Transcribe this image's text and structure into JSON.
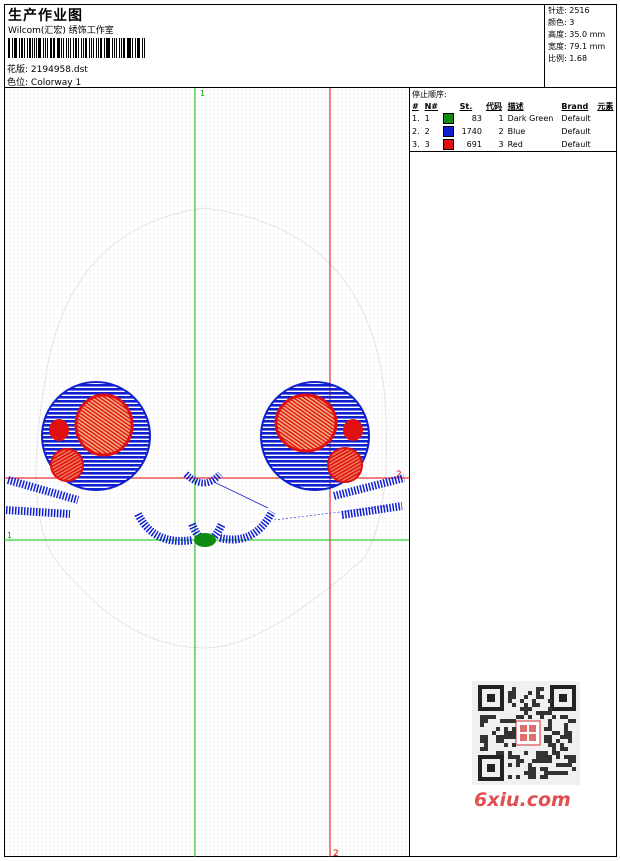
{
  "header": {
    "title": "生产作业图",
    "company": "Wilcom(汇宏) 绣饰工作室",
    "file_label": "花版:",
    "file_value": "2194958.dst",
    "colorway_label": "色位:",
    "colorway_value": "Colorway 1"
  },
  "stats": {
    "stitches": "针迹: 2516",
    "colors": "颜色: 3",
    "height": "高度: 35.0 mm",
    "width": "宽度: 79.1 mm",
    "scale": "比例: 1.68"
  },
  "stop_sequence": {
    "title": "停止顺序:",
    "headers": [
      "#",
      "N#",
      "St.",
      "代码",
      "描述",
      "Brand",
      "元素"
    ],
    "rows": [
      {
        "index": "1.",
        "n": "1",
        "color": "#118a11",
        "stitches": "83",
        "code": "1",
        "desc": "Dark Green",
        "brand": "Default"
      },
      {
        "index": "2.",
        "n": "2",
        "color": "#1020d0",
        "stitches": "1740",
        "code": "2",
        "desc": "Blue",
        "brand": "Default"
      },
      {
        "index": "3.",
        "n": "3",
        "color": "#e01010",
        "stitches": "691",
        "code": "3",
        "desc": "Red",
        "brand": "Default"
      }
    ]
  },
  "guides": {
    "v1": "1",
    "v2": "2",
    "h1": "1",
    "h2": "2"
  },
  "watermark": {
    "site": "6xiu.com"
  },
  "colors": {
    "green_guide": "#00c000",
    "red_guide": "#e00000",
    "blue_thread": "#1020d0",
    "red_thread": "#e01010",
    "green_thread": "#118a11"
  }
}
